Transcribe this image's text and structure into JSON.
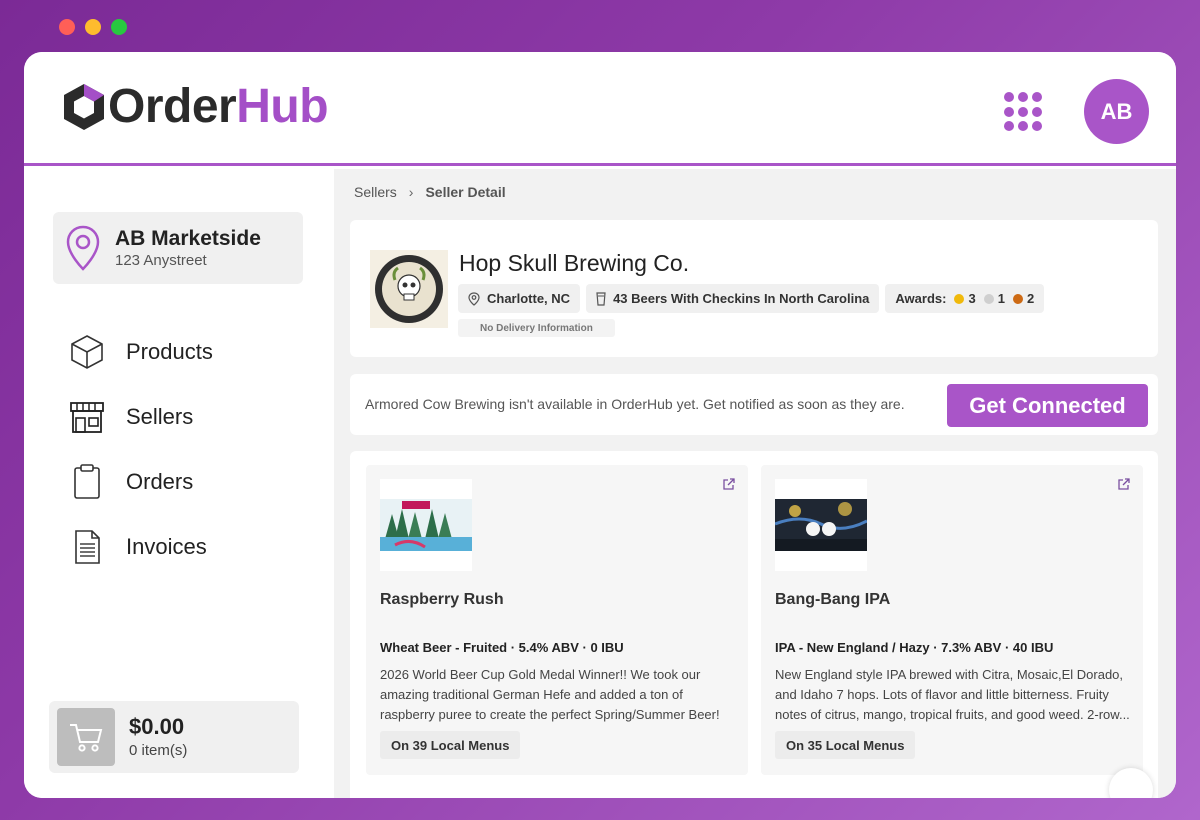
{
  "app": {
    "logo_order": "Order",
    "logo_hub": "Hub",
    "avatar_initials": "AB",
    "brand_color": "#a955c8"
  },
  "sidebar": {
    "location_name": "AB Marketside",
    "location_address": "123 Anystreet",
    "items": [
      {
        "label": "Products",
        "icon": "cube-icon"
      },
      {
        "label": "Sellers",
        "icon": "storefront-icon"
      },
      {
        "label": "Orders",
        "icon": "clipboard-icon"
      },
      {
        "label": "Invoices",
        "icon": "document-icon"
      }
    ],
    "cart_total": "$0.00",
    "cart_items": "0 item(s)"
  },
  "breadcrumb": {
    "parent": "Sellers",
    "current": "Seller Detail"
  },
  "seller": {
    "name": "Hop Skull Brewing Co.",
    "location": "Charlotte, NC",
    "beers": "43 Beers With Checkins In North Carolina",
    "awards_label": "Awards:",
    "awards_gold": "3",
    "awards_silver": "1",
    "awards_bronze": "2",
    "delivery": "No Delivery Information",
    "logo_text": "HOPSKULL"
  },
  "notify": {
    "text": "Armored Cow Brewing isn't available in OrderHub yet. Get notified as soon as they are.",
    "button_label": "Get Connected"
  },
  "products": [
    {
      "name": "Raspberry Rush",
      "meta": "Wheat Beer - Fruited · 5.4% ABV · 0 IBU",
      "description": "2026 World Beer Cup Gold Medal Winner!! We took our amazing traditional German Hefe and added a ton of raspberry puree to create the perfect Spring/Summer Beer!",
      "menus": "On 39 Local Menus"
    },
    {
      "name": "Bang-Bang IPA",
      "meta": "IPA - New England / Hazy · 7.3% ABV · 40 IBU",
      "description": "New England style IPA brewed with Citra, Mosaic,El Dorado, and Idaho 7 hops. Lots of flavor and little bitterness. Fruity notes of citrus, mango, tropical fruits, and good weed. 2-row...",
      "menus": "On 35 Local Menus"
    }
  ]
}
